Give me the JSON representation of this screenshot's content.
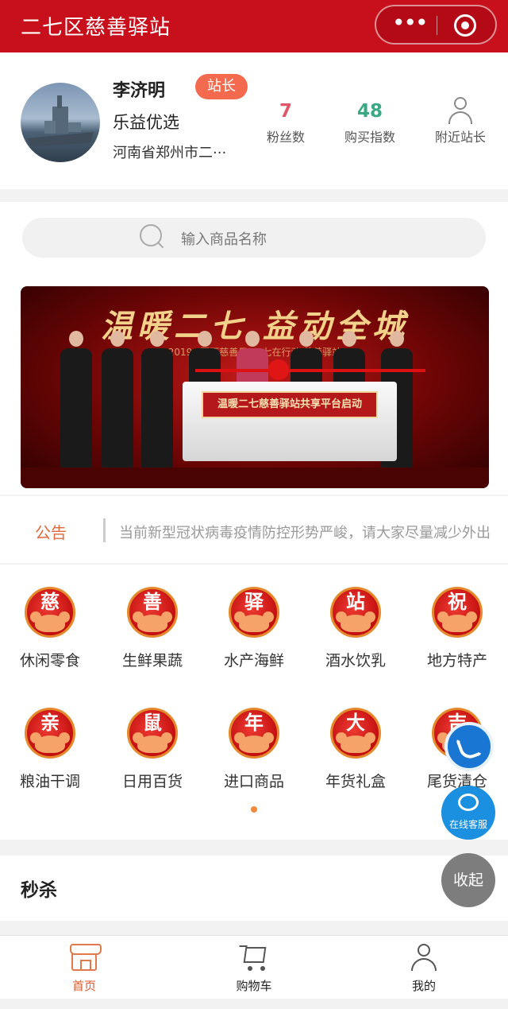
{
  "app": {
    "title": "二七区慈善驿站",
    "menu_icon": "more-dots-icon",
    "close_icon": "target-icon"
  },
  "profile": {
    "name": "李济明",
    "role_badge": "站长",
    "shop_name": "乐益优选",
    "address": "河南省郑州市二···",
    "stats": [
      {
        "value": "7",
        "label": "粉丝数",
        "color": "#e0566b"
      },
      {
        "value": "48",
        "label": "购买指数",
        "color": "#3aa883"
      },
      {
        "label": "附近站长",
        "icon": "person-icon"
      }
    ]
  },
  "search": {
    "placeholder": "输入商品名称"
  },
  "banner": {
    "headline": "温暖二七  益动全城",
    "subline": "2019 “百万慈善日”二七在行动 慈善驿站",
    "podium_sign": "温暖二七慈善驿站共享平台启动"
  },
  "notice": {
    "label": "公告",
    "text": "当前新型冠状病毒疫情防控形势严峻，请大家尽量减少外出"
  },
  "categories": [
    {
      "char": "慈",
      "label": "休闲零食"
    },
    {
      "char": "善",
      "label": "生鲜果蔬"
    },
    {
      "char": "驿",
      "label": "水产海鲜"
    },
    {
      "char": "站",
      "label": "酒水饮乳"
    },
    {
      "char": "祝",
      "label": "地方特产"
    },
    {
      "char": "亲",
      "label": "粮油干调"
    },
    {
      "char": "鼠",
      "label": "日用百货"
    },
    {
      "char": "年",
      "label": "进口商品"
    },
    {
      "char": "大",
      "label": "年货礼盒"
    },
    {
      "char": "吉",
      "label": "尾货清仓"
    }
  ],
  "flash_sale": {
    "title": "秒杀"
  },
  "floating": {
    "service_label": "在线客服",
    "collapse_label": "收起"
  },
  "tabbar": {
    "items": [
      {
        "label": "首页",
        "icon": "store-icon",
        "active": true
      },
      {
        "label": "购物车",
        "icon": "cart-icon",
        "active": false
      },
      {
        "label": "我的",
        "icon": "user-icon",
        "active": false
      }
    ]
  },
  "colors": {
    "brand": "#c8101c",
    "accent": "#e05a2a",
    "badge": "#f46a4e"
  }
}
